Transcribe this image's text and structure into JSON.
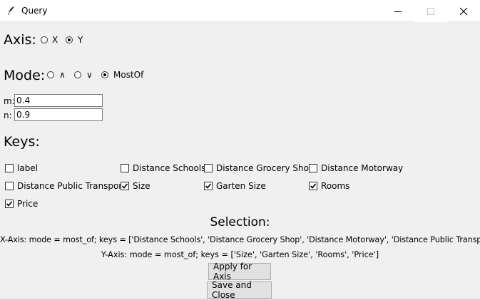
{
  "window": {
    "title": "Query",
    "icon": "feather-icon",
    "controls": [
      "minimize-icon",
      "maximize-icon",
      "close-icon"
    ]
  },
  "axis": {
    "label": "Axis:",
    "options": [
      {
        "label": "X",
        "selected": false
      },
      {
        "label": "Y",
        "selected": true
      }
    ]
  },
  "mode": {
    "label": "Mode:",
    "options": [
      {
        "label": "∧",
        "selected": false
      },
      {
        "label": "∨",
        "selected": false
      },
      {
        "label": "MostOf",
        "selected": true
      }
    ]
  },
  "params": {
    "m_label": "m:",
    "m_value": "0.4",
    "n_label": "n:",
    "n_value": "0.9"
  },
  "keys": {
    "label": "Keys:",
    "items": [
      {
        "label": "label",
        "checked": false
      },
      {
        "label": "Distance Schools",
        "checked": false
      },
      {
        "label": "Distance Grocery Shop",
        "checked": false
      },
      {
        "label": "Distance Motorway",
        "checked": false
      },
      {
        "label": "Distance Public Transport",
        "checked": false
      },
      {
        "label": "Size",
        "checked": true
      },
      {
        "label": "Garten Size",
        "checked": true
      },
      {
        "label": "Rooms",
        "checked": true
      },
      {
        "label": "Price",
        "checked": true
      }
    ]
  },
  "selection": {
    "heading": "Selection:",
    "x_axis": "X-Axis: mode = most_of; keys = ['Distance Schools', 'Distance Grocery Shop', 'Distance Motorway', 'Distance Public Transport']",
    "y_axis": "Y-Axis: mode = most_of; keys = ['Size', 'Garten Size', 'Rooms', 'Price']"
  },
  "buttons": {
    "apply": "Apply for Axis",
    "save": "Save and Close"
  }
}
